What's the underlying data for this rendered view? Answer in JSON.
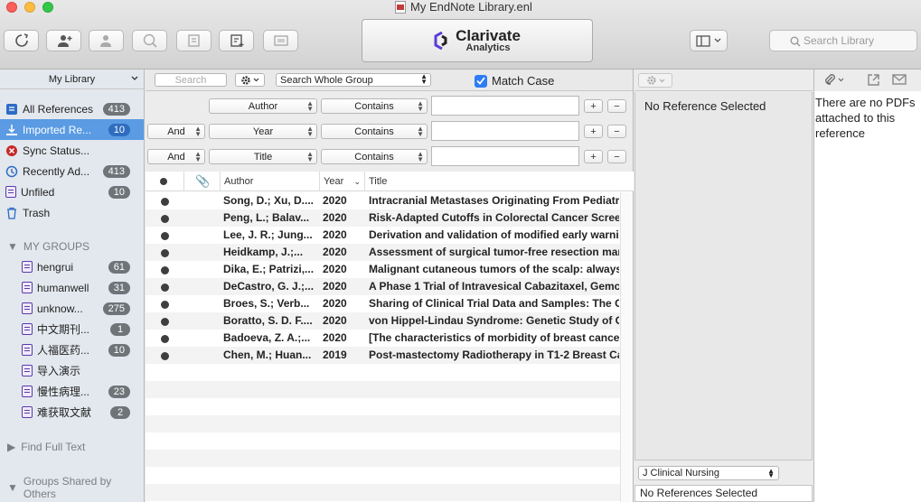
{
  "window": {
    "title": "My EndNote Library.enl"
  },
  "brand": {
    "name": "Clarivate",
    "sub": "Analytics"
  },
  "toolbar": {
    "search_placeholder": "Search Library"
  },
  "sidebar": {
    "library_select": "My Library",
    "items": [
      {
        "label": "All References",
        "count": "413",
        "icon": "all-references-icon"
      },
      {
        "label": "Imported Re...",
        "count": "10",
        "icon": "imported-icon"
      },
      {
        "label": "Sync Status...",
        "count": "",
        "icon": "sync-status-icon"
      },
      {
        "label": "Recently Ad...",
        "count": "413",
        "icon": "recently-added-icon"
      },
      {
        "label": "Unfiled",
        "count": "10",
        "icon": "unfiled-icon"
      },
      {
        "label": "Trash",
        "count": "",
        "icon": "trash-icon"
      }
    ],
    "my_groups_header": "MY GROUPS",
    "groups": [
      {
        "label": "hengrui",
        "count": "61"
      },
      {
        "label": "humanwell",
        "count": "31"
      },
      {
        "label": "unknow...",
        "count": "275"
      },
      {
        "label": "中文期刊...",
        "count": "1"
      },
      {
        "label": "人福医药...",
        "count": "10"
      },
      {
        "label": "导入演示",
        "count": ""
      },
      {
        "label": "慢性病理...",
        "count": "23"
      },
      {
        "label": "难获取文献",
        "count": "2"
      }
    ],
    "find_full_text": "Find Full Text",
    "groups_shared": "Groups Shared by Others"
  },
  "search": {
    "quick_placeholder": "Search",
    "scope": "Search Whole Group",
    "match_case_label": "Match Case",
    "match_case_checked": true,
    "rows": [
      {
        "bool": "",
        "field": "Author",
        "op": "Contains",
        "value": ""
      },
      {
        "bool": "And",
        "field": "Year",
        "op": "Contains",
        "value": ""
      },
      {
        "bool": "And",
        "field": "Title",
        "op": "Contains",
        "value": ""
      }
    ]
  },
  "table": {
    "headers": {
      "author": "Author",
      "year": "Year",
      "title": "Title"
    },
    "rows": [
      {
        "author": "Song, D.; Xu, D....",
        "year": "2020",
        "title": "Intracranial Metastases Originating From Pediatr"
      },
      {
        "author": "Peng, L.; Balav...",
        "year": "2020",
        "title": "Risk-Adapted Cutoffs in Colorectal Cancer Scree"
      },
      {
        "author": "Lee, J. R.; Jung...",
        "year": "2020",
        "title": "Derivation and validation of modified early warni"
      },
      {
        "author": "Heidkamp, J.;...",
        "year": "2020",
        "title": "Assessment of surgical tumor-free resection mar"
      },
      {
        "author": "Dika, E.; Patrizi,...",
        "year": "2020",
        "title": "Malignant cutaneous tumors of the scalp: always"
      },
      {
        "author": "DeCastro, G. J.;...",
        "year": "2020",
        "title": "A Phase 1 Trial of Intravesical Cabazitaxel, Gemc"
      },
      {
        "author": "Broes, S.; Verb...",
        "year": "2020",
        "title": "Sharing of Clinical Trial Data and Samples: The C"
      },
      {
        "author": "Boratto, S. D. F....",
        "year": "2020",
        "title": "von Hippel-Lindau Syndrome: Genetic Study of C"
      },
      {
        "author": "Badoeva, Z. A.;...",
        "year": "2020",
        "title": "[The characteristics of morbidity of breast cance"
      },
      {
        "author": "Chen, M.; Huan...",
        "year": "2019",
        "title": "Post-mastectomy Radiotherapy in T1-2 Breast Ca"
      }
    ]
  },
  "reference_panel": {
    "empty_text": "No Reference Selected"
  },
  "pdf_panel": {
    "empty_text": "There are no PDFs attached to this reference"
  },
  "style": {
    "selected": "J Clinical Nursing"
  },
  "preview": {
    "text": "No References Selected"
  },
  "colors": {
    "selection": "#5a9be3",
    "badge": "#6f7479",
    "accent": "#2e7cf6"
  }
}
